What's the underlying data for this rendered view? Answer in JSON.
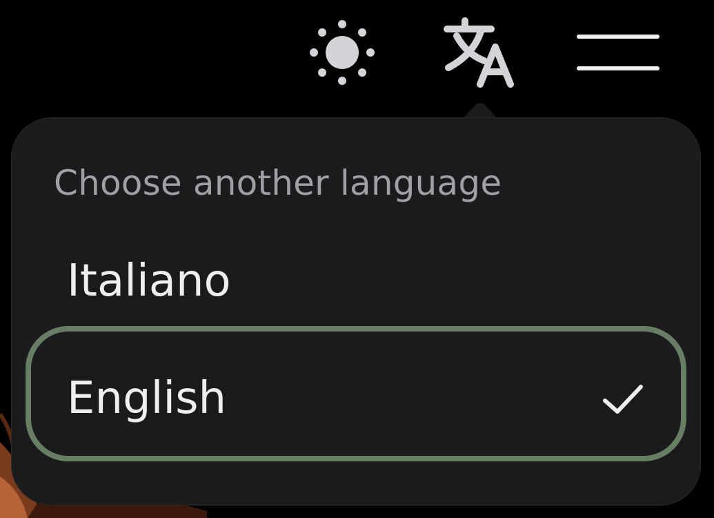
{
  "header": {
    "theme_icon": "sun-icon",
    "language_icon": "translate-icon",
    "menu_icon": "hamburger-menu-icon"
  },
  "language_popover": {
    "title": "Choose another language",
    "options": [
      {
        "label": "Italiano",
        "selected": false
      },
      {
        "label": "English",
        "selected": true,
        "icon": "checkmark-icon"
      }
    ]
  },
  "colors": {
    "background": "#000000",
    "popover_bg": "#1b1b1d",
    "selected_border": "#677d64",
    "title_text": "#a09fa6",
    "option_text": "#eeeef0",
    "icon": "#d4d4d8"
  }
}
